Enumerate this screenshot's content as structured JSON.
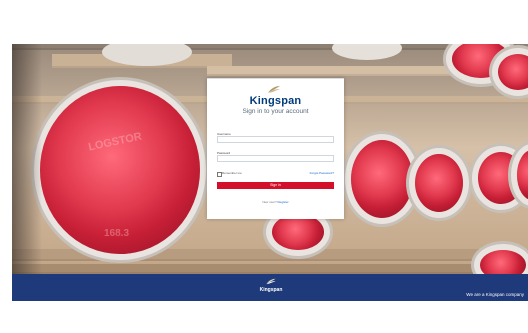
{
  "login": {
    "brand": "Kingspan",
    "subtitle": "Sign in to your account",
    "username_label": "Username",
    "password_label": "Password",
    "remember_label": "Remember me",
    "forgot_label": "Forgot Password?",
    "signin_label": "Sign in",
    "new_user_text": "New user?",
    "register_label": "Register"
  },
  "footer": {
    "brand": "Kingspan",
    "tagline": "We are a Kingspan company"
  },
  "background": {
    "drum_text_1": "LOGSTOR",
    "drum_text_2": "168.3"
  },
  "colors": {
    "brand_blue": "#003b7b",
    "footer_blue": "#1f3a7a",
    "signin_red": "#d40f2a",
    "link_blue": "#1a66c8"
  },
  "icons": [
    "kingspan-leaf-logo-icon",
    "checkbox-icon"
  ]
}
